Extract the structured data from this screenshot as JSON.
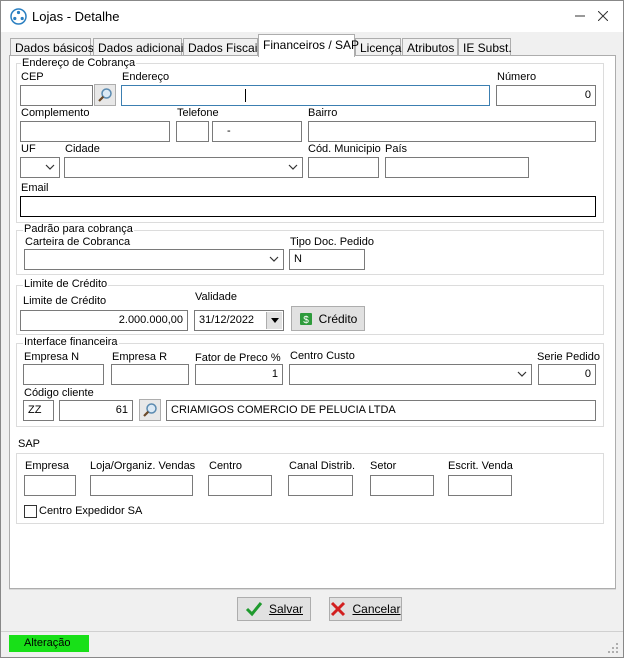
{
  "window": {
    "title": "Lojas - Detalhe"
  },
  "tabs": [
    {
      "label": "Dados básicos"
    },
    {
      "label": "Dados adicionais"
    },
    {
      "label": "Dados Fiscais"
    },
    {
      "label": "Financeiros / SAP"
    },
    {
      "label": "Licença"
    },
    {
      "label": "Atributos"
    },
    {
      "label": "IE Subst."
    }
  ],
  "cobranca": {
    "legend": "Endereço de Cobrança",
    "cep_label": "CEP",
    "cep_value": "",
    "endereco_label": "Endereço",
    "endereco_value": "",
    "numero_label": "Número",
    "numero_value": "0",
    "complemento_label": "Complemento",
    "complemento_value": "",
    "telefone_label": "Telefone",
    "telefone_ddd": "",
    "telefone_value": "-",
    "bairro_label": "Bairro",
    "bairro_value": "",
    "uf_label": "UF",
    "uf_value": "",
    "cidade_label": "Cidade",
    "cidade_value": "",
    "cod_municipio_label": "Cód. Municipio",
    "cod_municipio_value": "",
    "pais_label": "País",
    "pais_value": "",
    "email_label": "Email",
    "email_value": ""
  },
  "padrao": {
    "legend": "Padrão para cobrança",
    "carteira_label": "Carteira de Cobranca",
    "carteira_value": "",
    "tipo_doc_label": "Tipo Doc. Pedido",
    "tipo_doc_value": "N"
  },
  "limite": {
    "legend": "Limite de Crédito",
    "limite_label": "Limite de Crédito",
    "limite_value": "2.000.000,00",
    "validade_label": "Validade",
    "validade_value": "31/12/2022",
    "credito_button": "Crédito"
  },
  "interface": {
    "legend": "Interface financeira",
    "empresa_n_label": "Empresa N",
    "empresa_n_value": "",
    "empresa_r_label": "Empresa R",
    "empresa_r_value": "",
    "fator_label": "Fator de Preco %",
    "fator_value": "1",
    "centro_custo_label": "Centro Custo",
    "centro_custo_value": "",
    "serie_label": "Serie Pedido",
    "serie_value": "0",
    "codigo_cliente_label": "Código cliente",
    "codigo_prefix": "ZZ",
    "codigo_value": "61",
    "cliente_nome": "CRIAMIGOS COMERCIO DE PELUCIA LTDA"
  },
  "sap": {
    "legend": "SAP",
    "empresa_label": "Empresa",
    "empresa_value": "",
    "loja_label": "Loja/Organiz. Vendas",
    "loja_value": "",
    "centro_label": "Centro",
    "centro_value": "",
    "canal_label": "Canal Distrib.",
    "canal_value": "",
    "setor_label": "Setor",
    "setor_value": "",
    "escrit_label": "Escrit. Venda",
    "escrit_value": "",
    "centro_expedidor_label": "Centro Expedidor SA"
  },
  "buttons": {
    "salvar": "Salvar",
    "cancelar": "Cancelar"
  },
  "status": {
    "text": "Alteração",
    "color": "#18e018"
  }
}
